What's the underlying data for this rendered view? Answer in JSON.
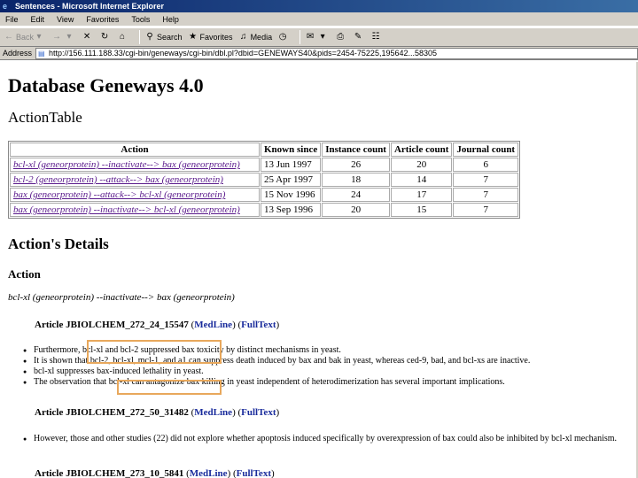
{
  "window": {
    "title": "Sentences - Microsoft Internet Explorer"
  },
  "menu": [
    "File",
    "Edit",
    "View",
    "Favorites",
    "Tools",
    "Help"
  ],
  "toolbar": {
    "back": "Back",
    "search": "Search",
    "favorites": "Favorites",
    "media": "Media"
  },
  "address": {
    "label": "Address",
    "url": "http://156.111.188.33/cgi-bin/geneways/cgi-bin/dbl.pl?dbid=GENEWAYS40&pids=2454-75225,195642...58305"
  },
  "page": {
    "title": "Database Geneways 4.0",
    "action_table_heading": "ActionTable",
    "table": {
      "headers": [
        "Action",
        "Known since",
        "Instance count",
        "Article count",
        "Journal count"
      ],
      "rows": [
        {
          "action": "bcl-xl (geneorprotein) --inactivate--> bax (geneorprotein)",
          "known_since": "13 Jun 1997",
          "instance_count": "26",
          "article_count": "20",
          "journal_count": "6"
        },
        {
          "action": "bcl-2 (geneorprotein) --attack--> bax (geneorprotein)",
          "known_since": "25 Apr 1997",
          "instance_count": "18",
          "article_count": "14",
          "journal_count": "7"
        },
        {
          "action": "bax (geneorprotein) --attack--> bcl-xl (geneorprotein)",
          "known_since": "15 Nov 1996",
          "instance_count": "24",
          "article_count": "17",
          "journal_count": "7"
        },
        {
          "action": "bax (geneorprotein) --inactivate--> bcl-xl (geneorprotein)",
          "known_since": "13 Sep 1996",
          "instance_count": "20",
          "article_count": "15",
          "journal_count": "7"
        }
      ]
    },
    "details_heading": "Action's Details",
    "action_heading": "Action",
    "action_line": "bcl-xl (geneorprotein) --inactivate--> bax (geneorprotein)",
    "articles": [
      {
        "label": "Article JBIOLCHEM_272_24_15547",
        "medline": "MedLine",
        "fulltext": "FullText",
        "sentences": [
          "Furthermore, bcl-xl and bcl-2 suppressed bax toxicity by distinct mechanisms in yeast.",
          "It is shown that bcl-2, bcl-xl, mcl-1, and a1 can suppress death induced by bax and bak in yeast, whereas ced-9, bad, and bcl-xs are inactive.",
          "bcl-xl suppresses bax-induced lethality in yeast.",
          "The observation that bcl-xl can antagonize bax killing in yeast independent of heterodimerization has several important implications."
        ]
      },
      {
        "label": "Article JBIOLCHEM_272_50_31482",
        "medline": "MedLine",
        "fulltext": "FullText",
        "sentences": [
          "However, those and other studies (22) did not explore whether apoptosis induced specifically by overexpression of bax could also be inhibited by bcl-xl mechanism."
        ]
      },
      {
        "label": "Article JBIOLCHEM_273_10_5841",
        "medline": "MedLine",
        "fulltext": "FullText",
        "sentences": []
      }
    ]
  },
  "colors": {
    "titlebar": "#0a246a",
    "chrome": "#d4d0c8",
    "visited_link": "#5a1a8c",
    "link": "#1a2c9c",
    "highlight": "#e8a85c"
  }
}
